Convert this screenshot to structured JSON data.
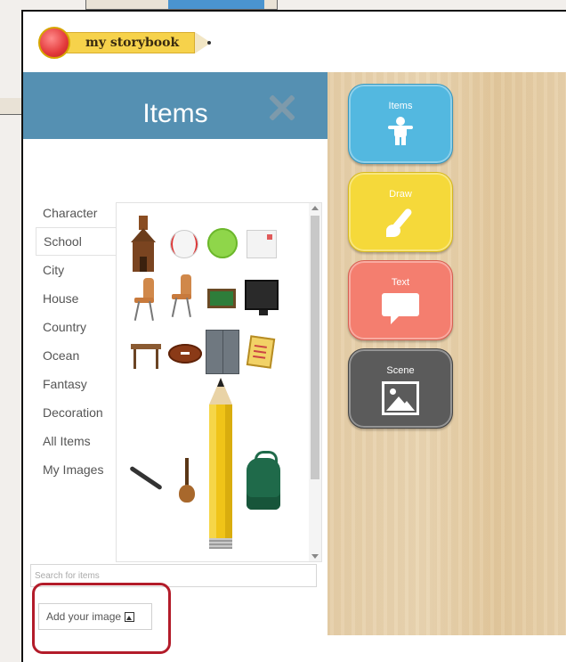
{
  "app": {
    "logo_text": "my storybook"
  },
  "panel": {
    "title": "Items",
    "categories": [
      "Character",
      "School",
      "City",
      "House",
      "Country",
      "Ocean",
      "Fantasy",
      "Decoration",
      "All Items",
      "My Images"
    ],
    "selected_category": "School",
    "search_placeholder": "Search for items",
    "add_image_label": "Add your image",
    "highlight_color": "#b31c2a"
  },
  "tools": [
    {
      "label": "Items",
      "icon": "person-icon",
      "color": "#53b8e0"
    },
    {
      "label": "Draw",
      "icon": "paintbrush-icon",
      "color": "#f5d93a"
    },
    {
      "label": "Text",
      "icon": "speech-bubble-icon",
      "color": "#f47e6f"
    },
    {
      "label": "Scene",
      "icon": "picture-icon",
      "color": "#5b5b5b"
    }
  ],
  "colors": {
    "header": "#5590b2",
    "canvas": "#e6cfa9"
  }
}
